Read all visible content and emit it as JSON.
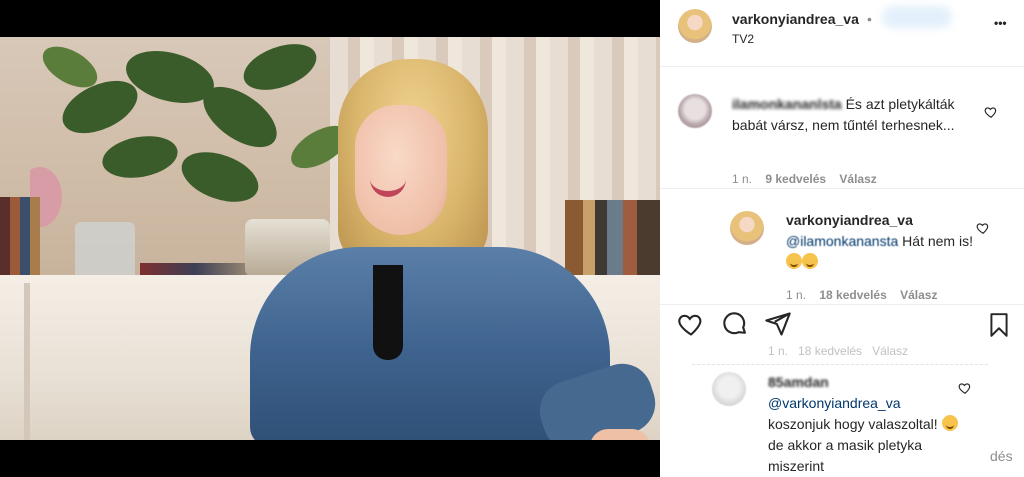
{
  "post": {
    "author": "varkonyiandrea_va",
    "dot": "•",
    "location": "TV2",
    "more_label": "•••"
  },
  "comments": [
    {
      "user": "ilamonkananlsta",
      "text": "És azt pletykálták babát vársz, nem tűntél terhesnek...",
      "time": "1 n.",
      "likes": "9 kedvelés",
      "reply": "Válasz"
    },
    {
      "user": "varkonyiandrea_va",
      "mention": "@ilamonkanansta",
      "text": "Hát nem is!",
      "time": "1 n.",
      "likes": "18 kedvelés",
      "reply": "Válasz"
    },
    {
      "user": "85amdan",
      "mention": "@varkonyiandrea_va",
      "text_a": "koszonjuk hogy valaszoltal!",
      "text_b": "de akkor a masik pletyka miszerint",
      "ghost_meta": "1 n.   18 kedvelés   Válasz"
    }
  ],
  "partial_right": "dés",
  "icons": {
    "like": "heart-icon",
    "comment": "comment-icon",
    "share": "share-icon",
    "save": "bookmark-icon"
  }
}
